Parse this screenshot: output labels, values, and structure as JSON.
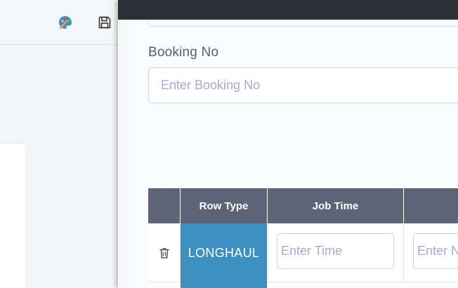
{
  "background": {
    "icons": [
      "palette-icon",
      "save-icon"
    ]
  },
  "form": {
    "booking_label": "Booking No",
    "booking_placeholder": "Enter Booking No"
  },
  "table": {
    "columns": [
      "",
      "Row Type",
      "Job Time",
      ""
    ],
    "rows": [
      {
        "row_type": "LONGHAUL",
        "job_time_placeholder": "Enter Time",
        "next_placeholder": "Enter N"
      }
    ]
  },
  "colors": {
    "header_bg": "#5d6478",
    "row_type_bg": "#3d8fc0",
    "topbar_bg": "#2b2f36",
    "placeholder": "#a7abd0"
  }
}
